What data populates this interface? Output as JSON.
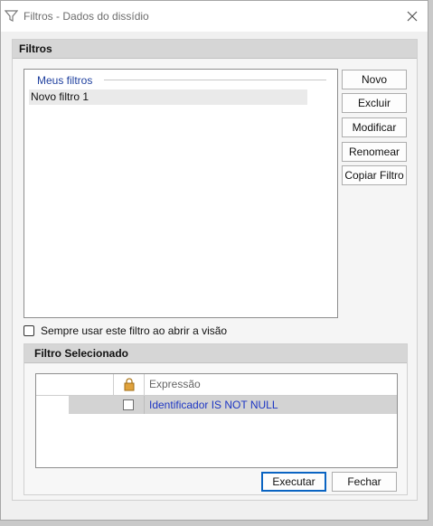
{
  "window": {
    "title": "Filtros - Dados do dissídio"
  },
  "filters_panel": {
    "header": "Filtros",
    "group_title": "Meus filtros",
    "items": [
      "Novo filtro 1"
    ],
    "buttons": {
      "new": "Novo",
      "delete": "Excluir",
      "modify": "Modificar",
      "rename": "Renomear",
      "copy": "Copiar Filtro"
    }
  },
  "always_use_checkbox": {
    "label": "Sempre usar este filtro ao abrir a visão",
    "checked": false
  },
  "selected_filter": {
    "header": "Filtro Selecionado",
    "column_expression": "Expressão",
    "rows": [
      {
        "locked": false,
        "expression": "Identificador IS NOT NULL"
      }
    ]
  },
  "footer": {
    "execute": "Executar",
    "close": "Fechar"
  },
  "colors": {
    "expression_text": "#1d36c4",
    "group_title": "#1e3f9e",
    "primary_border": "#0a64c2"
  }
}
